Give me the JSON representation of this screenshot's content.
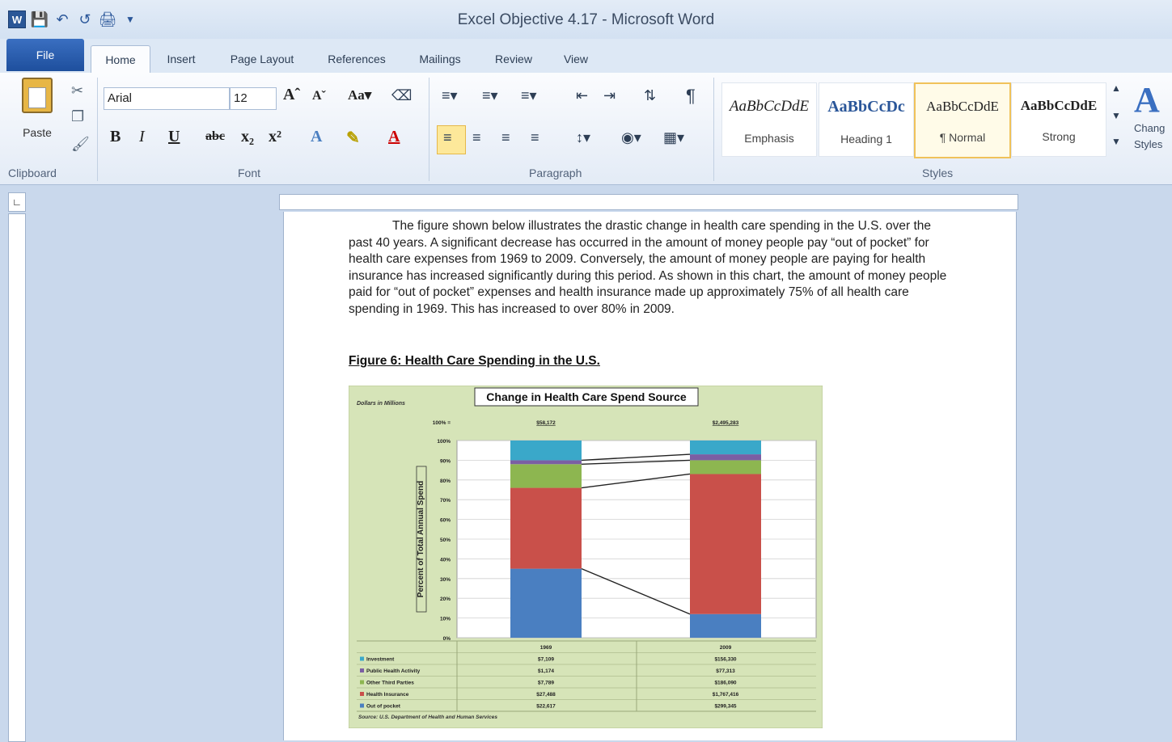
{
  "window": {
    "title": "Excel Objective 4.17 - Microsoft Word"
  },
  "ribbon_tabs": [
    "File",
    "Home",
    "Insert",
    "Page Layout",
    "References",
    "Mailings",
    "Review",
    "View"
  ],
  "active_tab": "Home",
  "clipboard": {
    "paste_label": "Paste",
    "group": "Clipboard"
  },
  "font": {
    "name": "Arial",
    "size": "12",
    "group": "Font"
  },
  "paragraph": {
    "group": "Paragraph"
  },
  "styles": {
    "group": "Styles",
    "items": [
      {
        "sample": "AaBbCcDdE",
        "name": "Emphasis"
      },
      {
        "sample": "AaBbCcDc",
        "name": "Heading 1"
      },
      {
        "sample": "AaBbCcDdE",
        "name": "¶ Normal"
      },
      {
        "sample": "AaBbCcDdE",
        "name": "Strong"
      }
    ],
    "change_label_1": "Chang",
    "change_label_2": "Styles"
  },
  "document": {
    "paragraph": "The figure shown below illustrates the drastic change in health care spending in the U.S. over the past 40 years.  A significant decrease has occurred in the amount of money people pay “out of pocket” for health care expenses from 1969 to 2009.  Conversely, the amount of money people are paying for health insurance has increased significantly during this period.  As shown in this chart, the amount of money people paid for “out of pocket” expenses and health insurance made up approximately 75% of all health care spending in 1969.  This has increased to over 80% in 2009.",
    "figure_title": "Figure 6: Health Care Spending in the U.S."
  },
  "chart_data": {
    "type": "bar",
    "stacked": true,
    "title": "Change in Health Care Spend Source",
    "units_note": "Dollars in Millions",
    "ylabel": "Percent of Total Annual Spend",
    "yticks": [
      "0%",
      "10%",
      "20%",
      "30%",
      "40%",
      "50%",
      "60%",
      "70%",
      "80%",
      "90%",
      "100%"
    ],
    "top_label": "100% =",
    "categories": [
      "1969",
      "2009"
    ],
    "totals": [
      "$58,172",
      "$2,495,283"
    ],
    "ylim": [
      0,
      100
    ],
    "series": [
      {
        "name": "Out of pocket",
        "color": "#4a7fc1",
        "values": [
          35,
          12
        ],
        "table": [
          "$22,617",
          "$299,345"
        ]
      },
      {
        "name": "Health Insurance",
        "color": "#c9504a",
        "values": [
          41,
          71
        ],
        "table": [
          "$27,488",
          "$1,767,416"
        ]
      },
      {
        "name": "Other Third Parties",
        "color": "#8db650",
        "values": [
          12,
          7
        ],
        "table": [
          "$7,789",
          "$186,090"
        ]
      },
      {
        "name": "Public Health Activity",
        "color": "#7b5fa3",
        "values": [
          2,
          3
        ],
        "table": [
          "$1,174",
          "$77,313"
        ]
      },
      {
        "name": "Investment",
        "color": "#3aa8c9",
        "values": [
          10,
          7
        ],
        "table": [
          "$7,109",
          "$156,330"
        ]
      }
    ],
    "source": "Source: U.S. Department of Health and Human Services",
    "colors": {
      "background": "#d6e4b8",
      "plot": "#ffffff"
    }
  }
}
